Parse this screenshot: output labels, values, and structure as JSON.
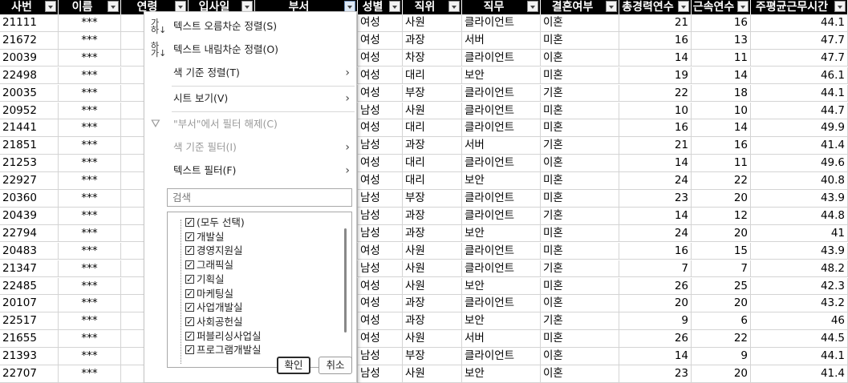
{
  "columns": [
    {
      "label": "사번",
      "filter_active": false
    },
    {
      "label": "이름",
      "filter_active": false
    },
    {
      "label": "연령",
      "filter_active": false
    },
    {
      "label": "입사일",
      "filter_active": false
    },
    {
      "label": "부서",
      "filter_active": true
    },
    {
      "label": "성별",
      "filter_active": false
    },
    {
      "label": "직위",
      "filter_active": false
    },
    {
      "label": "직무",
      "filter_active": false
    },
    {
      "label": "결혼여부",
      "filter_active": false
    },
    {
      "label": "총경력연수",
      "filter_active": false
    },
    {
      "label": "근속연수",
      "filter_active": false
    },
    {
      "label": "주평균근무시간",
      "filter_active": false
    }
  ],
  "rows": [
    [
      "21111",
      "***",
      "",
      "",
      "",
      "여성",
      "사원",
      "클라이언트",
      "이혼",
      "21",
      "16",
      "44.1"
    ],
    [
      "21672",
      "***",
      "",
      "",
      "",
      "여성",
      "과장",
      "서버",
      "미혼",
      "16",
      "13",
      "47.7"
    ],
    [
      "20039",
      "***",
      "",
      "",
      "",
      "여성",
      "차장",
      "클라이언트",
      "이혼",
      "14",
      "11",
      "47.7"
    ],
    [
      "22498",
      "***",
      "",
      "",
      "",
      "여성",
      "대리",
      "보안",
      "미혼",
      "19",
      "14",
      "46.1"
    ],
    [
      "20035",
      "***",
      "",
      "",
      "",
      "여성",
      "부장",
      "클라이언트",
      "기혼",
      "22",
      "18",
      "44.1"
    ],
    [
      "20952",
      "***",
      "",
      "",
      "",
      "남성",
      "사원",
      "클라이언트",
      "미혼",
      "10",
      "10",
      "44.7"
    ],
    [
      "21441",
      "***",
      "",
      "",
      "",
      "여성",
      "대리",
      "클라이언트",
      "미혼",
      "16",
      "14",
      "49.9"
    ],
    [
      "21851",
      "***",
      "",
      "",
      "",
      "남성",
      "과장",
      "서버",
      "기혼",
      "21",
      "16",
      "41.4"
    ],
    [
      "21253",
      "***",
      "",
      "",
      "",
      "여성",
      "대리",
      "클라이언트",
      "이혼",
      "14",
      "11",
      "49.6"
    ],
    [
      "22927",
      "***",
      "",
      "",
      "",
      "여성",
      "대리",
      "보안",
      "미혼",
      "24",
      "22",
      "40.8"
    ],
    [
      "20360",
      "***",
      "",
      "",
      "",
      "남성",
      "부장",
      "클라이언트",
      "미혼",
      "23",
      "20",
      "43.9"
    ],
    [
      "20439",
      "***",
      "",
      "",
      "",
      "남성",
      "과장",
      "클라이언트",
      "기혼",
      "14",
      "12",
      "44.8"
    ],
    [
      "22794",
      "***",
      "",
      "",
      "",
      "남성",
      "과장",
      "보안",
      "미혼",
      "24",
      "20",
      "41"
    ],
    [
      "20483",
      "***",
      "",
      "",
      "",
      "여성",
      "사원",
      "클라이언트",
      "미혼",
      "16",
      "15",
      "43.9"
    ],
    [
      "21347",
      "***",
      "",
      "",
      "",
      "남성",
      "사원",
      "클라이언트",
      "기혼",
      "7",
      "7",
      "48.2"
    ],
    [
      "22485",
      "***",
      "",
      "",
      "",
      "여성",
      "사원",
      "보안",
      "미혼",
      "26",
      "25",
      "42.3"
    ],
    [
      "20107",
      "***",
      "",
      "",
      "",
      "여성",
      "과장",
      "클라이언트",
      "이혼",
      "20",
      "20",
      "43.2"
    ],
    [
      "22517",
      "***",
      "",
      "",
      "",
      "여성",
      "과장",
      "보안",
      "기혼",
      "9",
      "6",
      "46"
    ],
    [
      "21655",
      "***",
      "",
      "",
      "",
      "여성",
      "사원",
      "서버",
      "미혼",
      "26",
      "22",
      "44.5"
    ],
    [
      "21393",
      "***",
      "",
      "",
      "",
      "남성",
      "부장",
      "클라이언트",
      "이혼",
      "14",
      "9",
      "44.1"
    ],
    [
      "22707",
      "***",
      "",
      "",
      "",
      "남성",
      "사원",
      "보안",
      "이혼",
      "23",
      "20",
      "41.4"
    ]
  ],
  "menu": {
    "sort_asc": "텍스트 오름차순 정렬(S)",
    "sort_desc": "텍스트 내림차순 정렬(O)",
    "sort_color": "색 기준 정렬(T)",
    "sheet_view": "시트 보기(V)",
    "clear_filter": "\"부서\"에서 필터 해제(C)",
    "color_filter": "색 기준 필터(I)",
    "text_filter": "텍스트 필터(F)",
    "search_placeholder": "검색",
    "items": [
      "(모두 선택)",
      "개발실",
      "경영지원실",
      "그래픽실",
      "기획실",
      "마케팅실",
      "사업개발실",
      "사회공헌실",
      "퍼블리싱사업실",
      "프로그램개발실"
    ],
    "ok": "확인",
    "cancel": "취소"
  },
  "colors": {
    "header_bg": "#000000",
    "header_text": "#ffffff",
    "grid": "#d4d4d4"
  }
}
